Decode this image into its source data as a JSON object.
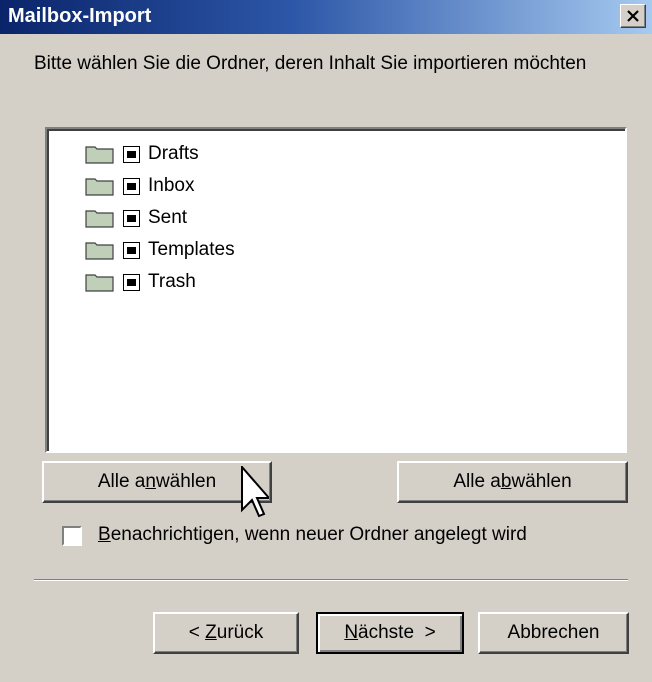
{
  "window": {
    "title": "Mailbox-Import",
    "close_label": "Close"
  },
  "prompt": "Bitte wählen Sie die Ordner, deren Inhalt Sie importieren möchten",
  "folders": [
    {
      "label": "Drafts",
      "checked": true
    },
    {
      "label": "Inbox",
      "checked": true
    },
    {
      "label": "Sent",
      "checked": true
    },
    {
      "label": "Templates",
      "checked": true
    },
    {
      "label": "Trash",
      "checked": true
    }
  ],
  "buttons": {
    "select_all": {
      "pre": "Alle a",
      "key": "n",
      "post": "wählen"
    },
    "deselect_all": {
      "pre": "Alle a",
      "key": "b",
      "post": "wählen"
    },
    "back": {
      "pre": "< ",
      "key": "Z",
      "post": "urück"
    },
    "next": {
      "pre": "",
      "key": "N",
      "post": "ächste  >"
    },
    "cancel": "Abbrechen"
  },
  "notify_checkbox": {
    "key": "B",
    "label": "enachrichtigen, wenn neuer Ordner angelegt wird",
    "checked": false
  },
  "colors": {
    "titlebar_start": "#0a246a",
    "titlebar_end": "#a6caf0",
    "face": "#d4d0c8",
    "folder": "#c0d0b8"
  }
}
